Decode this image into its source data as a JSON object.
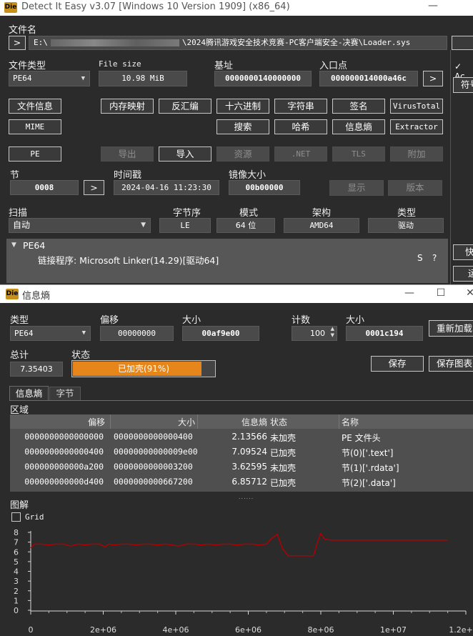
{
  "app": {
    "logo": "Die",
    "title": "Detect It Easy v3.07 [Windows 10 Version 1909] (x86_64)"
  },
  "main": {
    "file_name_label": "文件名",
    "file_path_prefix": "E:\\",
    "file_path_suffix": "\\2024腾讯游戏安全技术竞赛-PC客户端安全-决赛\\Loader.sys",
    "file_type_label": "文件类型",
    "file_type_value": "PE64",
    "file_size_label": "File size",
    "file_size_value": "10.98 MiB",
    "base_label": "基址",
    "base_value": "0000000140000000",
    "entry_label": "入口点",
    "entry_value": "000000014000a46c",
    "buttons_row1": [
      "文件信息",
      "内存映射",
      "反汇编",
      "十六进制",
      "字符串",
      "签名",
      "VirusTotal"
    ],
    "buttons_row2": [
      "MIME",
      "搜索",
      "哈希",
      "信息熵",
      "Extractor"
    ],
    "buttons_row3": [
      "PE",
      "导出",
      "导入",
      "资源",
      ".NET",
      "TLS",
      "附加"
    ],
    "section_label": "节",
    "section_value": "0008",
    "time_label": "时间戳",
    "time_value": "2024-04-16 11:23:30",
    "image_size_label": "镜像大小",
    "image_size_value": "00b00000",
    "show_btn": "显示",
    "version_btn": "版本",
    "scan_label": "扫描",
    "scan_value": "自动",
    "endian_label": "字节序",
    "endian_value": "LE",
    "mode_label": "模式",
    "mode_value": "64 位",
    "arch_label": "架构",
    "arch_value": "AMD64",
    "type_label": "类型",
    "type_value": "驱动",
    "result_root": "PE64",
    "result_linker": "链接程序: Microsoft Linker(14.29)[驱动64]",
    "result_s": "S",
    "result_q": "?",
    "right_check": "✓",
    "right_check_label": "Ac",
    "right_btn1": "符号",
    "right_btn2": "快",
    "right_btn3": "运"
  },
  "entropy": {
    "title": "信息熵",
    "type_label": "类型",
    "type_value": "PE64",
    "offset_label": "偏移",
    "offset_value": "00000000",
    "size_label": "大小",
    "size_value": "00af9e00",
    "count_label": "计数",
    "count_value": "100",
    "size2_label": "大小",
    "size2_value": "0001c194",
    "reload_btn": "重新加载",
    "total_label": "总计",
    "total_value": "7.35403",
    "status_label": "状态",
    "status_value": "已加壳(91%)",
    "status_progress": 0.91,
    "save_btn": "保存",
    "save_chart_btn": "保存图表",
    "tabs": [
      "信息熵",
      "字节"
    ],
    "region_label": "区域",
    "table_headers": [
      "偏移",
      "大小",
      "信息熵",
      "状态",
      "名称"
    ],
    "rows": [
      [
        "0000000000000000",
        "0000000000000400",
        "2.13566",
        "未加壳",
        "PE 文件头"
      ],
      [
        "0000000000000400",
        "00000000000009e00",
        "7.09524",
        "已加壳",
        "节(0)['.text']"
      ],
      [
        "000000000000a200",
        "0000000000003200",
        "3.62595",
        "未加壳",
        "节(1)['.rdata']"
      ],
      [
        "000000000000d400",
        "0000000000667200",
        "6.85712",
        "已加壳",
        "节(2)['.data']"
      ]
    ],
    "chart_label": "图解",
    "grid_label": "Grid"
  },
  "chart_data": {
    "type": "line",
    "xlim": [
      0,
      12000000
    ],
    "ylim": [
      0,
      8
    ],
    "y_ticks": [
      "0",
      "1",
      "2",
      "3",
      "4",
      "5",
      "6",
      "7",
      "8"
    ],
    "x_ticks": [
      "0",
      "2e+06",
      "4e+06",
      "6e+06",
      "8e+06",
      "1e+07",
      "1.2e+07"
    ],
    "x_tick_values": [
      0,
      2000000,
      4000000,
      6000000,
      8000000,
      10000000,
      12000000
    ],
    "grid": false,
    "series_color": "#b00000",
    "x": [
      0,
      100000,
      300000,
      500000,
      700000,
      900000,
      1100000,
      1300000,
      1500000,
      1700000,
      1900000,
      2050000,
      2150000,
      2300000,
      2500000,
      2700000,
      2900000,
      3100000,
      3300000,
      3500000,
      3700000,
      3900000,
      4100000,
      4300000,
      4500000,
      4700000,
      4900000,
      5100000,
      5300000,
      5500000,
      5700000,
      5900000,
      6100000,
      6300000,
      6500000,
      6650000,
      6800000,
      6950000,
      7100000,
      7300000,
      7500000,
      7700000,
      7800000,
      7900000,
      8000000,
      8100000,
      8300000,
      8500000,
      8700000,
      9000000,
      9500000,
      10000000,
      10500000,
      11000000,
      11500000
    ],
    "y": [
      6.4,
      6.8,
      6.8,
      6.7,
      6.8,
      6.8,
      6.6,
      6.8,
      6.7,
      6.8,
      6.8,
      6.5,
      6.8,
      6.7,
      6.8,
      6.8,
      6.7,
      6.8,
      6.8,
      6.7,
      6.8,
      6.7,
      6.6,
      6.8,
      6.8,
      6.7,
      6.8,
      6.7,
      6.8,
      6.8,
      6.7,
      6.8,
      6.8,
      6.7,
      6.8,
      7.4,
      7.8,
      6.3,
      5.6,
      5.6,
      5.6,
      5.6,
      5.6,
      6.9,
      7.9,
      7.3,
      7.2,
      7.2,
      7.2,
      7.2,
      7.2,
      7.2,
      7.2,
      7.2,
      7.2
    ]
  }
}
